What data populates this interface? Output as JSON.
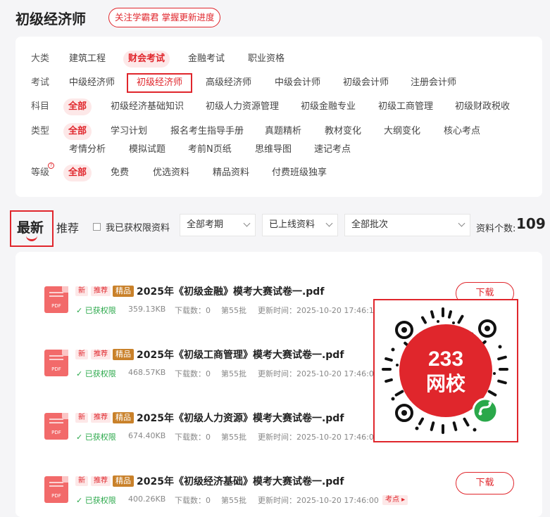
{
  "header": {
    "title": "初级经济师",
    "follow_label": "关注学霸君 掌握更新进度"
  },
  "filters": {
    "rows": [
      {
        "label": "大类",
        "options": [
          "建筑工程",
          "财会考试",
          "金融考试",
          "职业资格"
        ],
        "active": 1
      },
      {
        "label": "考试",
        "options": [
          "中级经济师",
          "初级经济师",
          "高级经济师",
          "中级会计师",
          "初级会计师",
          "注册会计师"
        ],
        "active": 1
      },
      {
        "label": "科目",
        "options": [
          "全部",
          "初级经济基础知识",
          "初级人力资源管理",
          "初级金融专业",
          "初级工商管理",
          "初级财政税收"
        ],
        "active": 0
      },
      {
        "label": "类型",
        "options": [
          "全部",
          "学习计划",
          "报名考生指导手册",
          "真题精析",
          "教材变化",
          "大纲变化",
          "核心考点",
          "考情分析",
          "模拟试题",
          "考前N页纸",
          "思维导图",
          "速记考点"
        ],
        "active": 0
      },
      {
        "label": "等级",
        "options": [
          "全部",
          "免费",
          "优选资料",
          "精品资料",
          "付费班级独享"
        ],
        "active": 0
      }
    ],
    "level_sup": "?"
  },
  "toolbar": {
    "tab_latest": "最新",
    "tab_recommend": "推荐",
    "checkbox_label": "我已获权限资料",
    "selects": [
      "全部考期",
      "已上线资料",
      "全部批次"
    ],
    "count_label": "资料个数:",
    "count_value": "109"
  },
  "badges": {
    "new": "新",
    "recommend": "推荐",
    "premium": "精品"
  },
  "pdf_label": "PDF",
  "download_label": "下载",
  "items": [
    {
      "title": "2025年《初级金融》模考大赛试卷一.pdf",
      "access": "已获权限",
      "size": "359.13KB",
      "downloads": "下载数：0",
      "batch": "第55批",
      "updated": "更新时间：2025-10-20 17:46:14"
    },
    {
      "title": "2025年《初级工商管理》模考大赛试卷一.pdf",
      "access": "已获权限",
      "size": "468.57KB",
      "downloads": "下载数：0",
      "batch": "第55批",
      "updated": "更新时间：2025-10-20 17:46:09"
    },
    {
      "title": "2025年《初级人力资源》模考大赛试卷一.pdf",
      "access": "已获权限",
      "size": "674.40KB",
      "downloads": "下载数：0",
      "batch": "第55批",
      "updated": "更新时间：2025-10-20 17:46:04"
    },
    {
      "title": "2025年《初级经济基础》模考大赛试卷一.pdf",
      "access": "已获权限",
      "size": "400.26KB",
      "downloads": "下载数：0",
      "batch": "第55批",
      "updated": "更新时间：2025-10-20 17:46:00",
      "tag": "考点"
    }
  ],
  "qr": {
    "brand_top": "233",
    "brand_bottom": "网校"
  },
  "colors": {
    "accent": "#e0262c",
    "success": "#2aa84a",
    "premium": "#c9812a"
  }
}
